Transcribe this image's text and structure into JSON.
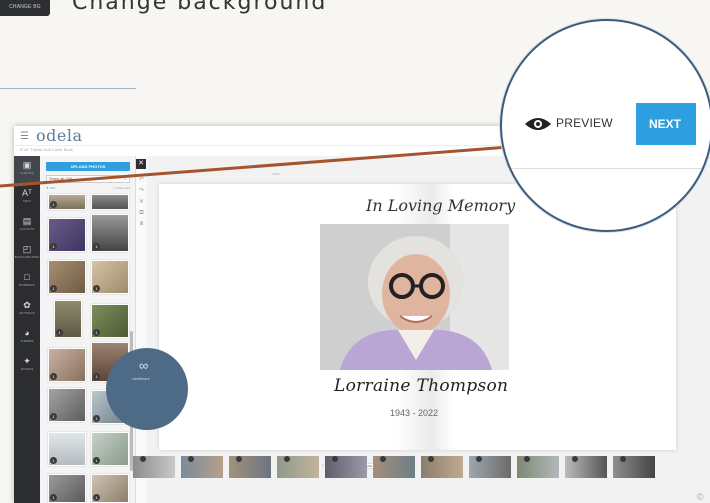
{
  "slide": {
    "title": "Change background",
    "corner_mark": "©"
  },
  "top_icon": {
    "label": "CHANGE BG"
  },
  "app": {
    "logo": "odela",
    "subtitle": "8\"x8\" Tribute Soft Cover Book"
  },
  "leftnav": [
    {
      "icon": "image-icon",
      "label": "PHOTOS"
    },
    {
      "icon": "text-icon",
      "label": "TEXT"
    },
    {
      "icon": "layout-icon",
      "label": "LAYOUTS"
    },
    {
      "icon": "background-icon",
      "label": "BACKGROUNDS"
    },
    {
      "icon": "border-icon",
      "label": "BORDERS"
    },
    {
      "icon": "settings-icon",
      "label": "SETTINGS"
    },
    {
      "icon": "palette-icon",
      "label": "THEMES"
    },
    {
      "icon": "sparkle-icon",
      "label": "EXTRAS"
    }
  ],
  "panel": {
    "upload_label": "UPLOAD PHOTOS",
    "filter_value": "Show all (34)",
    "sort_left": "▼ Sort",
    "sort_right": "☐ Hide used"
  },
  "canvas": {
    "zoom_label": "100%",
    "left_page": {
      "emblem_text": "rabbitcare"
    },
    "right_page": {
      "script_heading": "In Loving Memory",
      "name": "Lorraine Thompson",
      "years": "1943 - 2022"
    }
  },
  "pager": {
    "prev": "‹",
    "next": "›",
    "workspace_label": "WORKSPACE"
  },
  "magnifier": {
    "preview_label": "PREVIEW",
    "next_label": "NEXT"
  },
  "colors": {
    "accent": "#2d9fe0",
    "arrow": "#a5552e",
    "nav_bg": "#2c2d31",
    "emblem": "#4d6b86"
  },
  "photo_count_badge": "1"
}
